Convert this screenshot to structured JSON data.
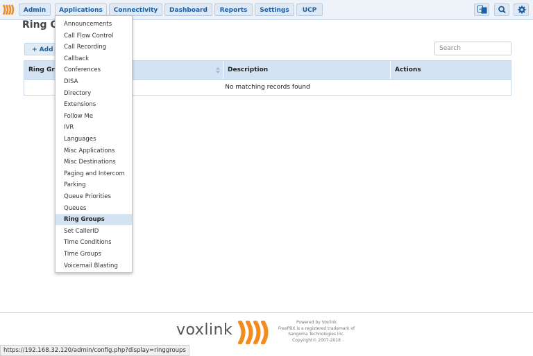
{
  "nav": {
    "items": [
      "Admin",
      "Applications",
      "Connectivity",
      "Dashboard",
      "Reports",
      "Settings",
      "UCP"
    ],
    "icons": [
      "translate-icon",
      "search-icon",
      "gear-icon"
    ]
  },
  "page": {
    "title": "Ring Gr",
    "add_button": "+ Add",
    "search_placeholder": "Search"
  },
  "table": {
    "columns": [
      "Ring Gro",
      "Description",
      "Actions"
    ],
    "empty_message": "No matching records found"
  },
  "dropdown": {
    "items": [
      "Announcements",
      "Call Flow Control",
      "Call Recording",
      "Callback",
      "Conferences",
      "DISA",
      "Directory",
      "Extensions",
      "Follow Me",
      "IVR",
      "Languages",
      "Misc Applications",
      "Misc Destinations",
      "Paging and Intercom",
      "Parking",
      "Queue Priorities",
      "Queues",
      "Ring Groups",
      "Set CallerID",
      "Time Conditions",
      "Time Groups",
      "Voicemail Blasting"
    ],
    "selected": "Ring Groups"
  },
  "footer": {
    "brand": "voxlink",
    "lines": [
      "Powered by Voxlink",
      "FreePBX is a registered trademark of",
      "Sangoma Technologies Inc.",
      "Copyright© 2007-2018"
    ]
  },
  "status_url": "https://192.168.32.120/admin/config.php?display=ringgroups",
  "colors": {
    "accent": "#1d5fa0",
    "brand_orange": "#f28c1e"
  }
}
